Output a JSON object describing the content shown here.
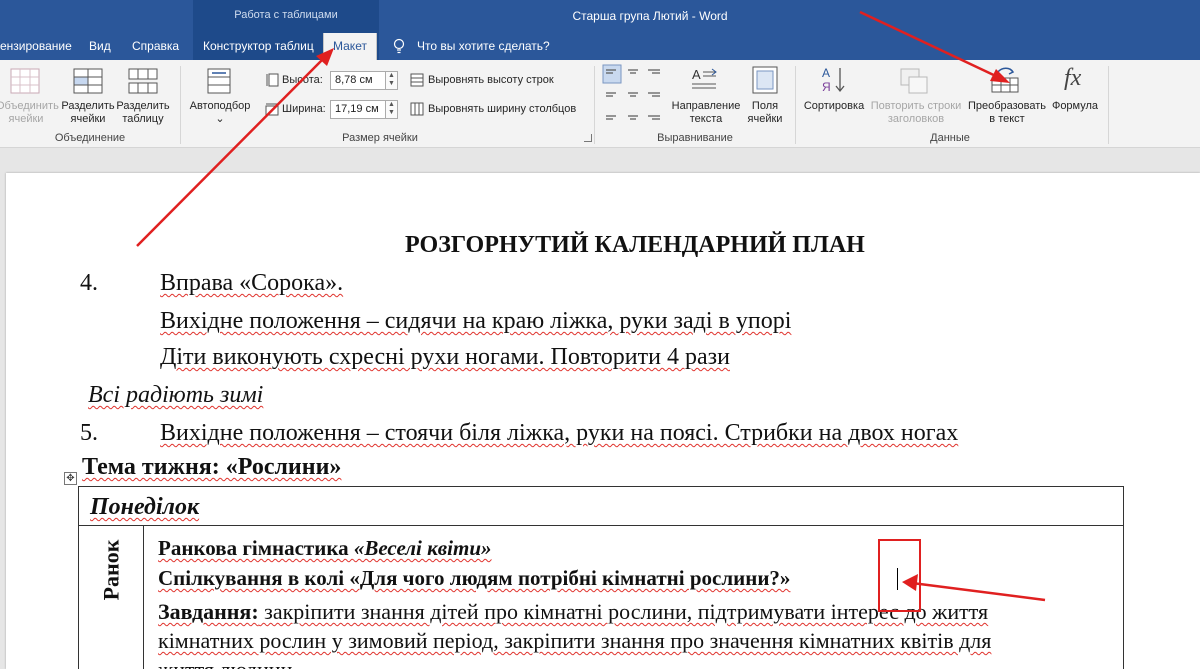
{
  "titlebar": {
    "context_group": "Работа с таблицами",
    "doc_title": "Старша група Лютий  -  Word"
  },
  "tabs": {
    "review": "ензирование",
    "view": "Вид",
    "help": "Справка",
    "design": "Конструктор таблиц",
    "layout": "Макет",
    "tell_me": "Что вы хотите сделать?"
  },
  "ribbon": {
    "merge_group": {
      "merge_cells": [
        "Объединить",
        "ячейки"
      ],
      "split_cells": [
        "Разделить",
        "ячейки"
      ],
      "split_table": [
        "Разделить",
        "таблицу"
      ],
      "label": "Объединение"
    },
    "cell_size": {
      "autofit": "Автоподбор",
      "height_label": "Высота:",
      "height_value": "8,78 см",
      "width_label": "Ширина:",
      "width_value": "17,19 см",
      "distribute_rows": "Выровнять высоту строк",
      "distribute_cols": "Выровнять ширину столбцов",
      "label": "Размер ячейки"
    },
    "alignment": {
      "text_direction": [
        "Направление",
        "текста"
      ],
      "cell_margins": [
        "Поля",
        "ячейки"
      ],
      "label": "Выравнивание"
    },
    "data": {
      "sort": "Сортировка",
      "repeat_header": [
        "Повторить строки",
        "заголовков"
      ],
      "convert_text": [
        "Преобразовать",
        "в текст"
      ],
      "formula": "Формула",
      "label": "Данные"
    }
  },
  "document": {
    "heading": "РОЗГОРНУТИЙ КАЛЕНДАРНИЙ ПЛАН",
    "item4_num": "4.",
    "item4_title": "Вправа «Сорока».",
    "item4_line2": "Вихідне положення – сидячи на краю ліжка, руки заді в упорі",
    "item4_line3": "Діти виконують схресні рухи ногами. Повторити 4 рази",
    "italic_line": "Всі радіють зимі",
    "item5_num": "5.",
    "item5_text": "Вихідне положення – стоячи біля ліжка, руки на поясі. Стрибки на двох ногах",
    "theme": "Тема тижня: «Рослини»",
    "day": "Понеділок",
    "row_label": "Ранок",
    "morning_ex_bold": "Ранкова гімнастика ",
    "morning_ex_ital": "«Веселі квіти»",
    "circle_talk": "Спілкування в колі «Для чого людям потрібні кімнатні рослини?»",
    "task_bold": "Завдання:",
    "task_line1": " закріпити знання дітей про кімнатні рослини, підтримувати інтерес до життя",
    "task_line2": "кімнатних рослин у зимовий період, закріпити знання про значення кімнатних квітів для",
    "task_line3": "життя людини"
  },
  "annotations": {
    "arrow_color": "#e02020"
  }
}
